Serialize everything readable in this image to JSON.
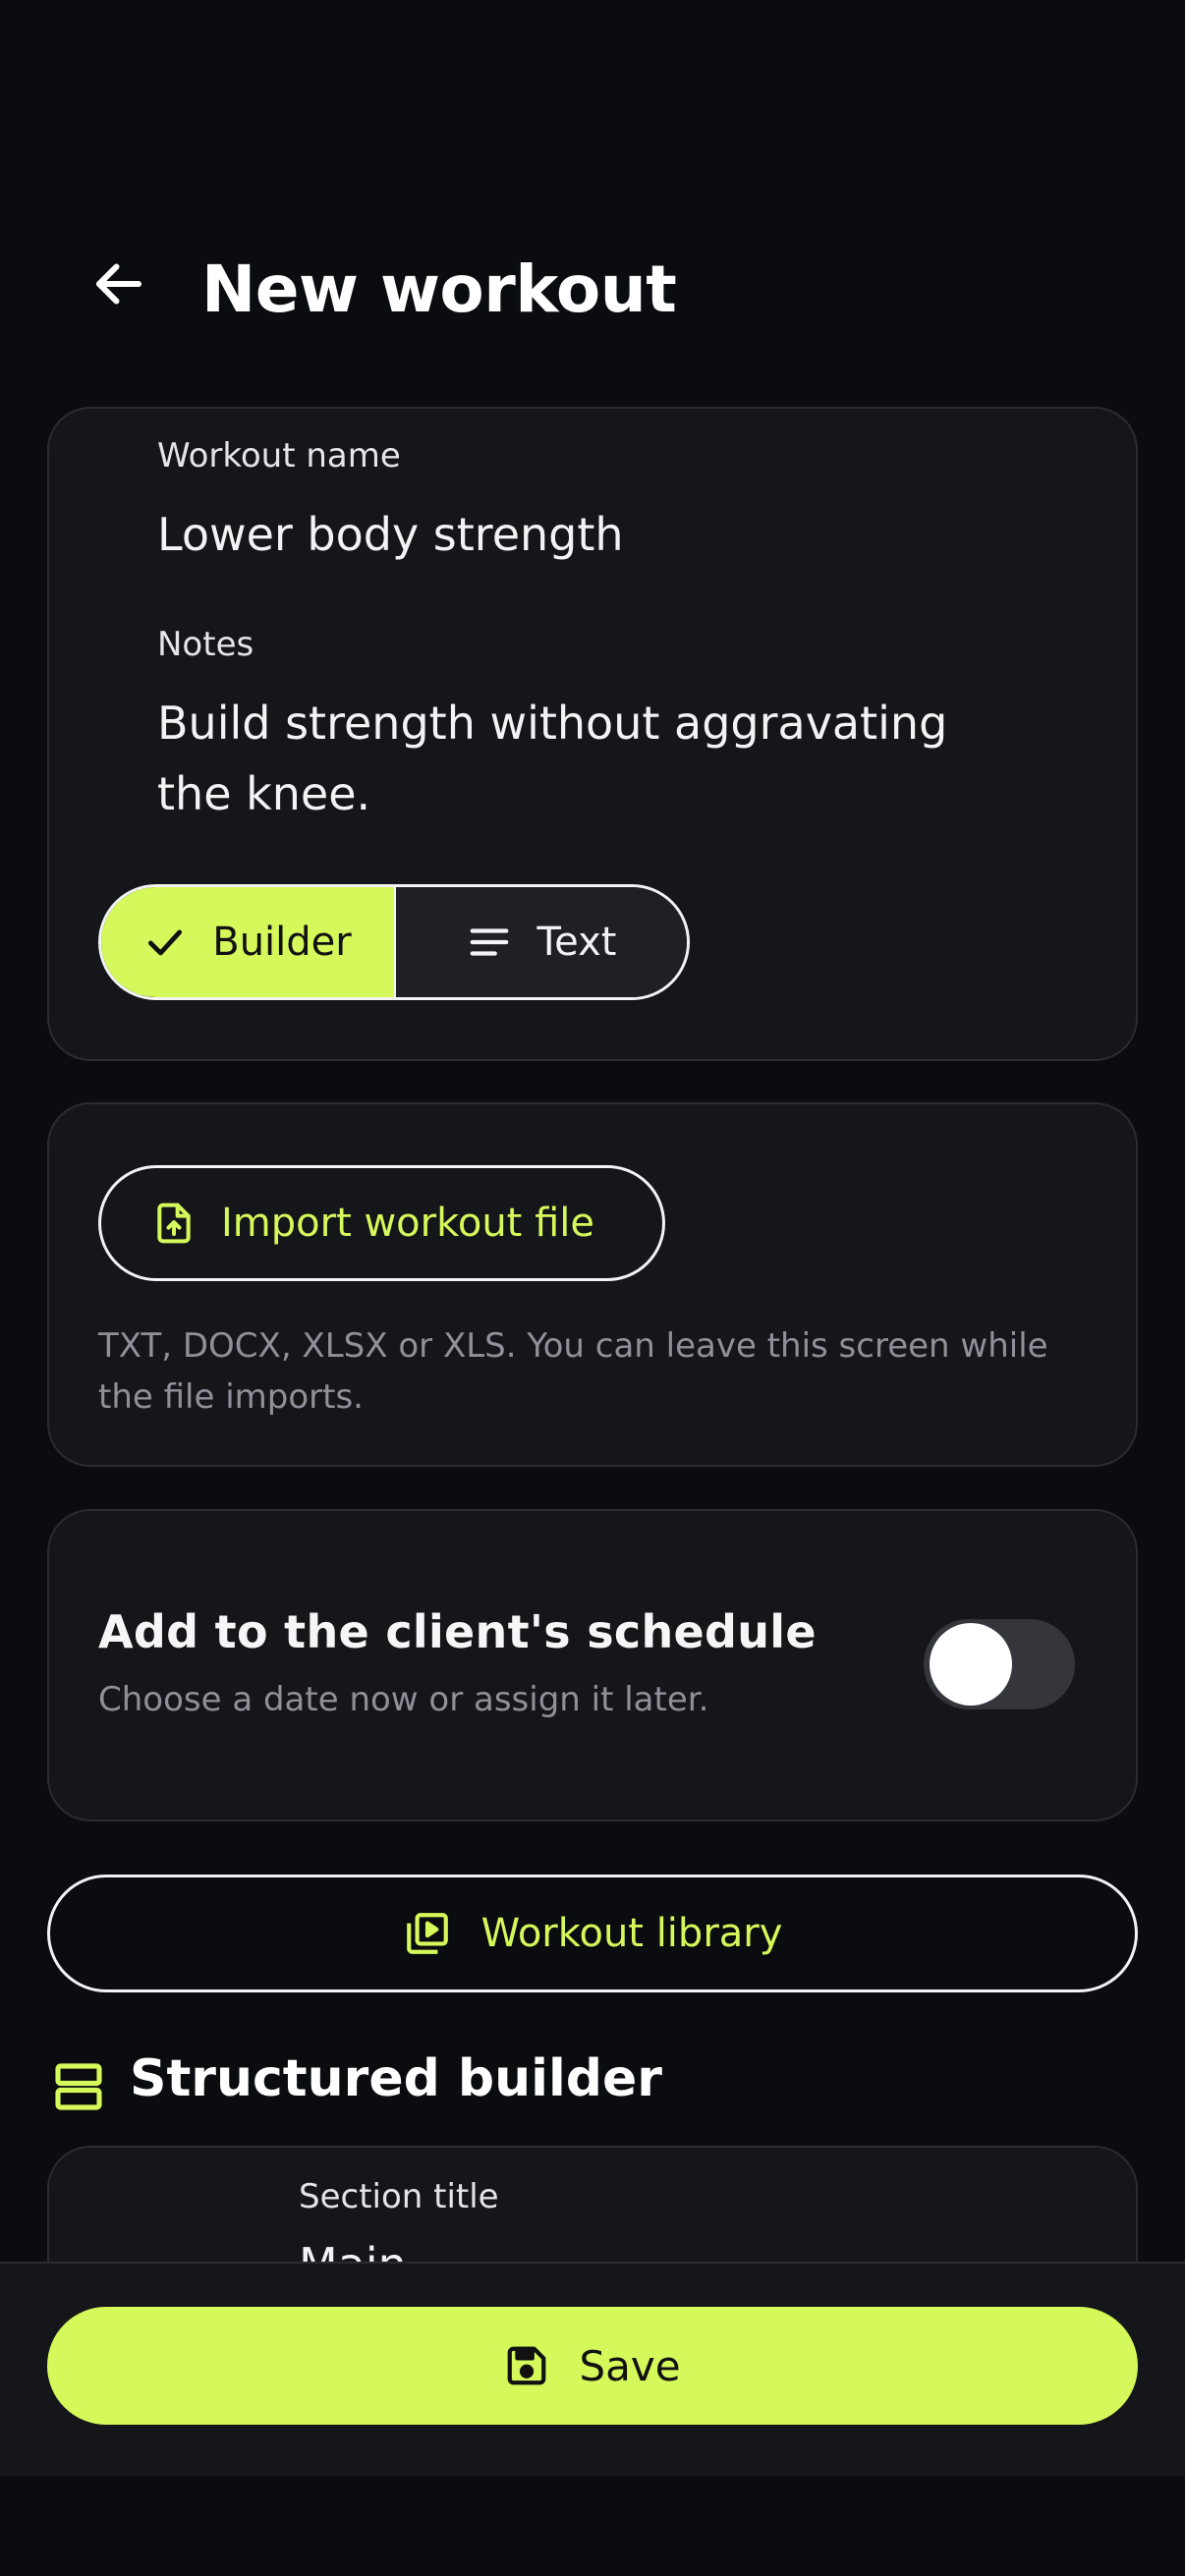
{
  "header": {
    "title": "New workout",
    "back_icon": "arrow-left-icon"
  },
  "details": {
    "name_label": "Workout name",
    "name_value": "Lower body strength",
    "notes_label": "Notes",
    "notes_line1": "Build strength without aggravating",
    "notes_line2": "the knee.",
    "mode": {
      "selected": "Builder",
      "builder_label": "Builder",
      "text_label": "Text"
    }
  },
  "import": {
    "button_label": "Import workout file",
    "help_text": "TXT, DOCX, XLSX or XLS. You can leave this screen while the file imports."
  },
  "schedule": {
    "title": "Add to the client's schedule",
    "subtitle": "Choose a date now or assign it later.",
    "toggle_on": false
  },
  "library": {
    "button_label": "Workout library"
  },
  "structured_builder": {
    "title": "Structured builder",
    "section_label": "Section title",
    "section_value": "Main"
  },
  "footer": {
    "save_label": "Save"
  },
  "colors": {
    "accent": "#d5f85a",
    "background": "#0b0c0f",
    "card": "#15161a",
    "border": "#2a2c31",
    "muted_text": "#8e9199"
  }
}
